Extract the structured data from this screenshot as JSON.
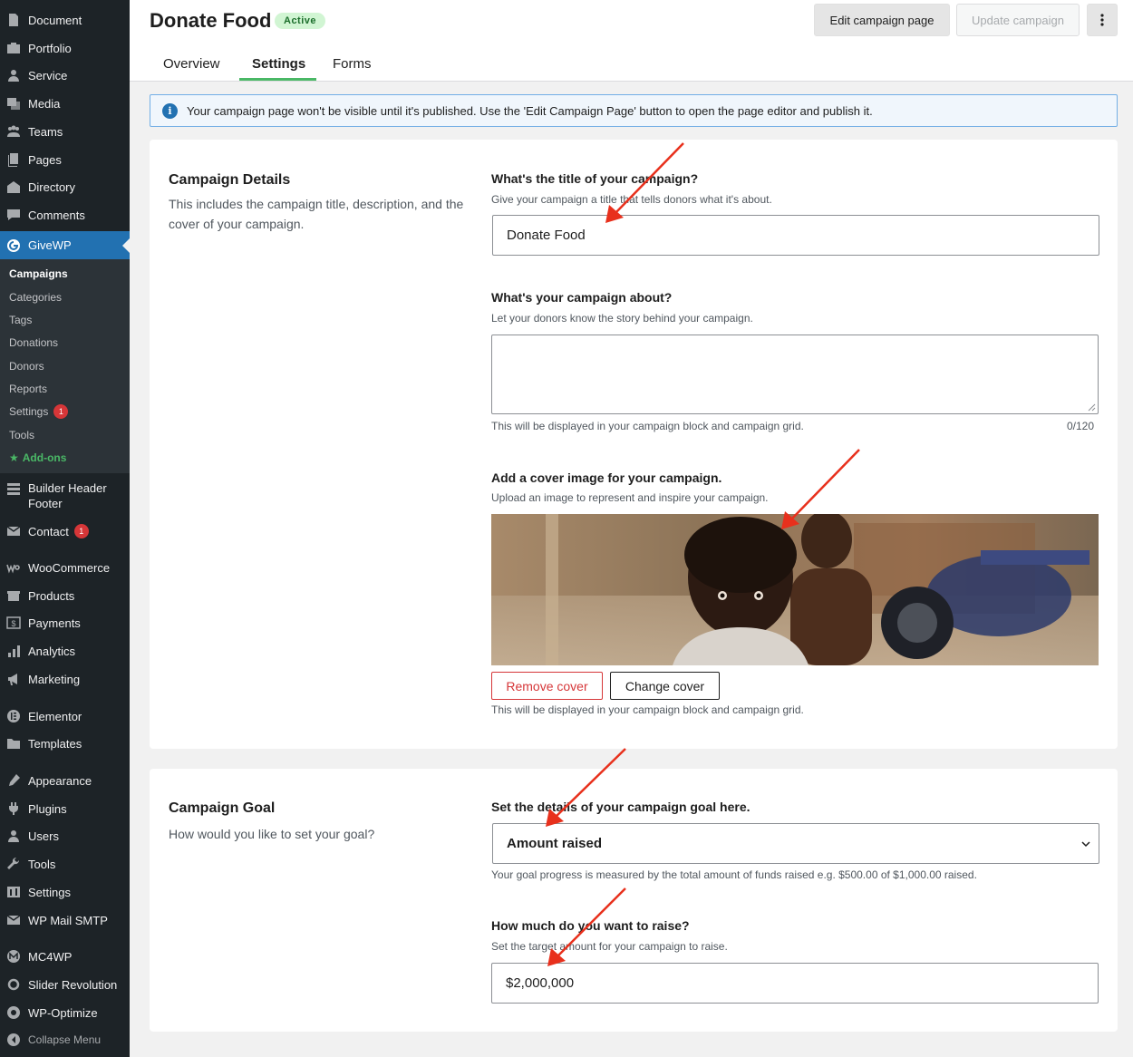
{
  "sidebar": {
    "items": [
      {
        "label": "Document",
        "icon": "document-icon"
      },
      {
        "label": "Portfolio",
        "icon": "portfolio-icon"
      },
      {
        "label": "Service",
        "icon": "service-icon"
      },
      {
        "label": "Media",
        "icon": "media-icon"
      },
      {
        "label": "Teams",
        "icon": "teams-icon"
      },
      {
        "label": "Pages",
        "icon": "pages-icon"
      },
      {
        "label": "Directory",
        "icon": "directory-icon"
      },
      {
        "label": "Comments",
        "icon": "comments-icon"
      },
      {
        "label": "GiveWP",
        "icon": "givewp-icon"
      },
      {
        "label": "Builder Header",
        "label2": "Footer",
        "icon": "builder-icon"
      },
      {
        "label": "Contact",
        "icon": "contact-icon",
        "badge": "1"
      },
      {
        "label": "WooCommerce",
        "icon": "woocommerce-icon"
      },
      {
        "label": "Products",
        "icon": "products-icon"
      },
      {
        "label": "Payments",
        "icon": "payments-icon"
      },
      {
        "label": "Analytics",
        "icon": "analytics-icon"
      },
      {
        "label": "Marketing",
        "icon": "marketing-icon"
      },
      {
        "label": "Elementor",
        "icon": "elementor-icon"
      },
      {
        "label": "Templates",
        "icon": "templates-icon"
      },
      {
        "label": "Appearance",
        "icon": "appearance-icon"
      },
      {
        "label": "Plugins",
        "icon": "plugins-icon"
      },
      {
        "label": "Users",
        "icon": "users-icon"
      },
      {
        "label": "Tools",
        "icon": "tools-icon"
      },
      {
        "label": "Settings",
        "icon": "settings-icon"
      },
      {
        "label": "WP Mail SMTP",
        "icon": "mail-icon"
      },
      {
        "label": "MC4WP",
        "icon": "mc4wp-icon"
      },
      {
        "label": "Slider Revolution",
        "icon": "slider-icon"
      },
      {
        "label": "WP-Optimize",
        "icon": "optimize-icon"
      }
    ],
    "submenu": [
      {
        "label": "Campaigns"
      },
      {
        "label": "Categories"
      },
      {
        "label": "Tags"
      },
      {
        "label": "Donations"
      },
      {
        "label": "Donors"
      },
      {
        "label": "Reports"
      },
      {
        "label": "Settings",
        "badge": "1"
      },
      {
        "label": "Tools"
      },
      {
        "label": "Add-ons"
      }
    ],
    "collapse_label": "Collapse Menu"
  },
  "header": {
    "title": "Donate Food",
    "status": "Active",
    "edit_button": "Edit campaign page",
    "update_button": "Update campaign",
    "tabs": [
      {
        "label": "Overview"
      },
      {
        "label": "Settings"
      },
      {
        "label": "Forms"
      }
    ]
  },
  "notice": {
    "text": "Your campaign page won't be visible until it's published. Use the 'Edit Campaign Page' button to open the page editor and publish it."
  },
  "details": {
    "title": "Campaign Details",
    "description": "This includes the campaign title, description, and the cover of your campaign.",
    "title_label": "What's the title of your campaign?",
    "title_help": "Give your campaign a title that tells donors what it's about.",
    "title_value": "Donate Food",
    "about_label": "What's your campaign about?",
    "about_help": "Let your donors know the story behind your campaign.",
    "about_value": "",
    "about_note": "This will be displayed in your campaign block and campaign grid.",
    "about_counter": "0/120",
    "cover_label": "Add a cover image for your campaign.",
    "cover_help": "Upload an image to represent and inspire your campaign.",
    "remove_cover": "Remove cover",
    "change_cover": "Change cover",
    "cover_note": "This will be displayed in your campaign block and campaign grid."
  },
  "goal": {
    "title": "Campaign Goal",
    "description": "How would you like to set your goal?",
    "type_label": "Set the details of your campaign goal here.",
    "type_value": "Amount raised",
    "type_help": "Your goal progress is measured by the total amount of funds raised e.g. $500.00 of $1,000.00 raised.",
    "amount_label": "How much do you want to raise?",
    "amount_help": "Set the target amount for your campaign to raise.",
    "amount_value": "$2,000,000"
  },
  "colors": {
    "sidebar_bg": "#1d2327",
    "active_blue": "#2271b1",
    "accent_green": "#4ab866",
    "danger_red": "#d63638",
    "arrow_red": "#e8301c"
  }
}
